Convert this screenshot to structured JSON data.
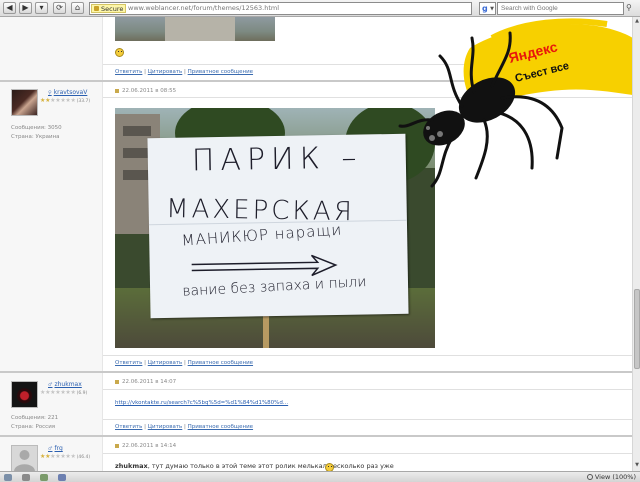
{
  "browser": {
    "secure_label": "Secure",
    "url": "www.weblancer.net/forum/themes/12563.html",
    "search_placeholder": "Search with Google",
    "search_engine_letter": "g",
    "zoom_label": "View (100%)"
  },
  "post_actions": {
    "reply": "Ответить",
    "quote": "Цитировать",
    "private": "Приватное сообщение",
    "separator": "|"
  },
  "posts": [
    {
      "user": "kravtsovaV",
      "stars_on": 2,
      "stars_total": 7,
      "rank": "(33.7)",
      "messages": "Сообщения: 3050",
      "country": "Страна: Украина",
      "date": "22.06.2011 в 08:55"
    },
    {
      "user": "zhukmax",
      "stars_on": 0,
      "stars_total": 7,
      "rank": "(6.9)",
      "messages": "Сообщения: 221",
      "country": "Страна: Россия",
      "date": "22.06.2011 в 14:07",
      "link": "http://vkontakte.ru/search?c%5bq%5d=%d1%84%d1%80%d..."
    },
    {
      "user": "frg",
      "stars_on": 2,
      "stars_total": 7,
      "rank": "(46.4)",
      "date": "22.06.2011 в 14:14",
      "reply_author": "zhukmax",
      "reply_text": ", тут думаю только в этой теме этот ролик мелькал несколько раз уже"
    }
  ],
  "sign_lines": [
    "ПАРИК –",
    "МАХЕРСКАЯ",
    "МАНИКЮР наращи",
    "вание без запаха и пыли"
  ],
  "ad": {
    "brand": "Яндекс",
    "tagline": "Съест все",
    "colors": {
      "yellow": "#f7d000",
      "red": "#e8170b",
      "spider": "#111111"
    }
  }
}
